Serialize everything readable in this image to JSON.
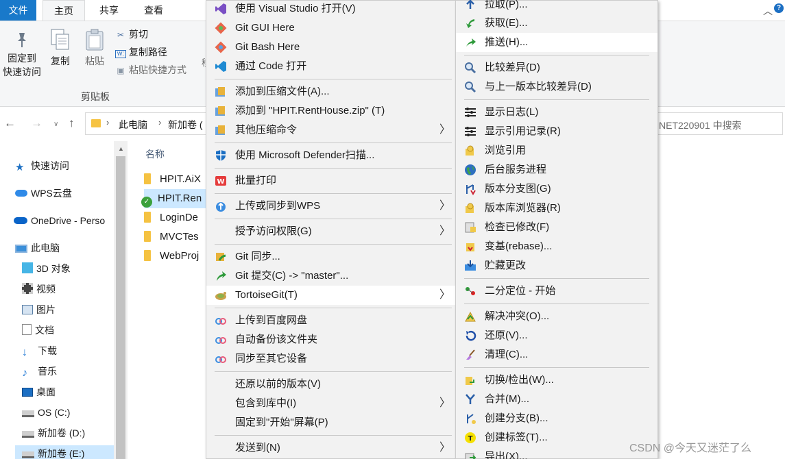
{
  "ribbon": {
    "tabs": [
      "文件",
      "主页",
      "共享",
      "查看"
    ],
    "pin_label_1": "固定到",
    "pin_label_2": "快速访问",
    "copy_label": "复制",
    "paste_label": "粘贴",
    "cut_label": "剪切",
    "copy_path_label": "复制路径",
    "paste_shortcut_label": "粘贴快捷方式",
    "group_label": "剪贴板",
    "cut_off_char": "移"
  },
  "address": {
    "crumbs": [
      "此电脑",
      "新加卷 ("
    ],
    "search_placeholder": "NET220901 中搜索"
  },
  "sidebar": {
    "items": [
      {
        "label": "快速访问",
        "icon": "star-icon",
        "color": "#1c6fc3"
      },
      {
        "label": "WPS云盘",
        "icon": "cloud-icon",
        "color": "#2f8ae8"
      },
      {
        "label": "OneDrive - Perso",
        "icon": "onedrive-icon",
        "color": "#0a64c8"
      },
      {
        "label": "此电脑",
        "icon": "computer-icon",
        "color": "#3b8fd9"
      },
      {
        "label": "3D 对象",
        "icon": "cube-icon",
        "color": "#46b5e6"
      },
      {
        "label": "视频",
        "icon": "film-icon",
        "color": "#444444"
      },
      {
        "label": "图片",
        "icon": "picture-icon",
        "color": "#5a7fa6"
      },
      {
        "label": "文档",
        "icon": "document-icon",
        "color": "#8a8a8a"
      },
      {
        "label": "下载",
        "icon": "download-icon",
        "color": "#2a7ed6"
      },
      {
        "label": "音乐",
        "icon": "music-icon",
        "color": "#2a7ed6"
      },
      {
        "label": "桌面",
        "icon": "desktop-icon",
        "color": "#1c6fc3"
      },
      {
        "label": "OS (C:)",
        "icon": "drive-icon",
        "color": "#888888"
      },
      {
        "label": "新加卷 (D:)",
        "icon": "drive-icon",
        "color": "#888888"
      },
      {
        "label": "新加卷 (E:)",
        "icon": "drive-icon",
        "color": "#888888"
      }
    ]
  },
  "filelist": {
    "column_name": "名称",
    "rows": [
      "HPIT.AiX",
      "HPIT.Ren",
      "LoginDe",
      "MVCTes",
      "WebProj"
    ]
  },
  "menu_main": {
    "items": [
      {
        "label": "使用 Visual Studio 打开(V)",
        "icon": "visual-studio-icon"
      },
      {
        "label": "Git GUI Here",
        "icon": "git-gui-icon"
      },
      {
        "label": "Git Bash Here",
        "icon": "git-bash-icon"
      },
      {
        "label": "通过 Code 打开",
        "icon": "vscode-icon"
      },
      {
        "label": "添加到压缩文件(A)...",
        "icon": "archive-icon"
      },
      {
        "label": "添加到 \"HPIT.RentHouse.zip\" (T)",
        "icon": "archive-icon"
      },
      {
        "label": "其他压缩命令",
        "icon": "archive-icon"
      },
      {
        "label": "使用 Microsoft Defender扫描...",
        "icon": "defender-shield-icon"
      },
      {
        "label": "批量打印",
        "icon": "wps-icon"
      },
      {
        "label": "上传或同步到WPS",
        "icon": "cloud-upload-icon"
      },
      {
        "label": "授予访问权限(G)",
        "icon": ""
      },
      {
        "label": "Git 同步...",
        "icon": "git-sync-icon"
      },
      {
        "label": "Git 提交(C) -> \"master\"...",
        "icon": "git-commit-icon"
      },
      {
        "label": "TortoiseGit(T)",
        "icon": "tortoisegit-icon"
      },
      {
        "label": "上传到百度网盘",
        "icon": "baidu-icon"
      },
      {
        "label": "自动备份该文件夹",
        "icon": "baidu-icon"
      },
      {
        "label": "同步至其它设备",
        "icon": "baidu-icon"
      },
      {
        "label": "还原以前的版本(V)",
        "icon": ""
      },
      {
        "label": "包含到库中(I)",
        "icon": ""
      },
      {
        "label": "固定到\"开始\"屏幕(P)",
        "icon": ""
      },
      {
        "label": "发送到(N)",
        "icon": ""
      }
    ]
  },
  "menu_sub": {
    "items": [
      {
        "label": "拉取(P)...",
        "icon": "pull-icon"
      },
      {
        "label": "获取(E)...",
        "icon": "fetch-icon"
      },
      {
        "label": "推送(H)...",
        "icon": "push-icon"
      },
      {
        "label": "比较差异(D)",
        "icon": "diff-icon"
      },
      {
        "label": "与上一版本比较差异(D)",
        "icon": "diff-icon"
      },
      {
        "label": "显示日志(L)",
        "icon": "log-icon"
      },
      {
        "label": "显示引用记录(R)",
        "icon": "reflog-icon"
      },
      {
        "label": "浏览引用",
        "icon": "browse-refs-icon"
      },
      {
        "label": "后台服务进程",
        "icon": "globe-icon"
      },
      {
        "label": "版本分支图(G)",
        "icon": "revision-graph-icon"
      },
      {
        "label": "版本库浏览器(R)",
        "icon": "repo-browser-icon"
      },
      {
        "label": "检查已修改(F)",
        "icon": "check-modifications-icon"
      },
      {
        "label": "变基(rebase)...",
        "icon": "rebase-icon"
      },
      {
        "label": "贮藏更改",
        "icon": "stash-icon"
      },
      {
        "label": "二分定位 - 开始",
        "icon": "bisect-icon"
      },
      {
        "label": "解决冲突(O)...",
        "icon": "resolve-icon"
      },
      {
        "label": "还原(V)...",
        "icon": "revert-icon"
      },
      {
        "label": "清理(C)...",
        "icon": "cleanup-icon"
      },
      {
        "label": "切换/检出(W)...",
        "icon": "switch-icon"
      },
      {
        "label": "合并(M)...",
        "icon": "merge-icon"
      },
      {
        "label": "创建分支(B)...",
        "icon": "branch-icon"
      },
      {
        "label": "创建标签(T)...",
        "icon": "tag-icon"
      },
      {
        "label": "导出(X)...",
        "icon": "export-icon"
      }
    ]
  },
  "watermark": "CSDN @今天又迷茫了么",
  "colors": {
    "accent": "#1979ca",
    "menu_bg": "#f2f2f2",
    "highlight": "#ffffff",
    "selection": "#cce8ff"
  }
}
